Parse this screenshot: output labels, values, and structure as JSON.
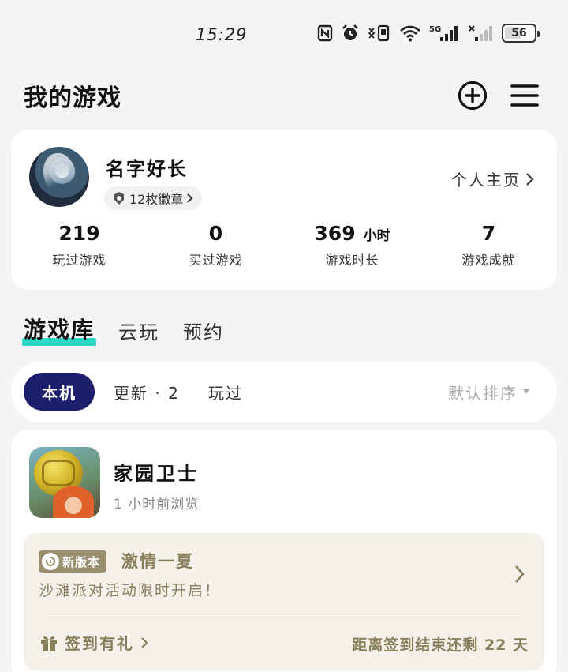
{
  "status_bar": {
    "time": "15:29",
    "battery": "56",
    "network": "5G",
    "icons": [
      "nfc-icon",
      "alarm-icon",
      "vibrate-icon",
      "wifi-icon",
      "signal-5g-icon",
      "signal-icon",
      "battery-icon"
    ]
  },
  "header": {
    "title": "我的游戏",
    "add_icon": "plus-circle-icon",
    "menu_icon": "menu-icon"
  },
  "profile": {
    "username": "名字好长",
    "badge_text": "12枚徽章",
    "homepage_link": "个人主页",
    "stats": [
      {
        "value": "219",
        "unit": "",
        "label": "玩过游戏"
      },
      {
        "value": "0",
        "unit": "",
        "label": "买过游戏"
      },
      {
        "value": "369",
        "unit": "小时",
        "label": "游戏时长"
      },
      {
        "value": "7",
        "unit": "",
        "label": "游戏成就"
      }
    ]
  },
  "library_tabs": [
    {
      "label": "游戏库",
      "active": true
    },
    {
      "label": "云玩",
      "active": false
    },
    {
      "label": "预约",
      "active": false
    }
  ],
  "filters": {
    "active": "本机",
    "update": "更新 · 2",
    "played": "玩过",
    "sort": "默认排序"
  },
  "game": {
    "title": "家园卫士",
    "subtitle": "1 小时前浏览",
    "promo": {
      "tag": "新版本",
      "title": "激情一夏",
      "description": "沙滩派对活动限时开启！",
      "checkin": "签到有礼",
      "countdown": "距离签到结束还剩 22 天"
    }
  },
  "colors": {
    "accent_navy": "#1e1e6e",
    "tab_underline": "#2fd9c6",
    "promo_bg": "#f3f1ea",
    "promo_text": "#8a7f5c"
  }
}
